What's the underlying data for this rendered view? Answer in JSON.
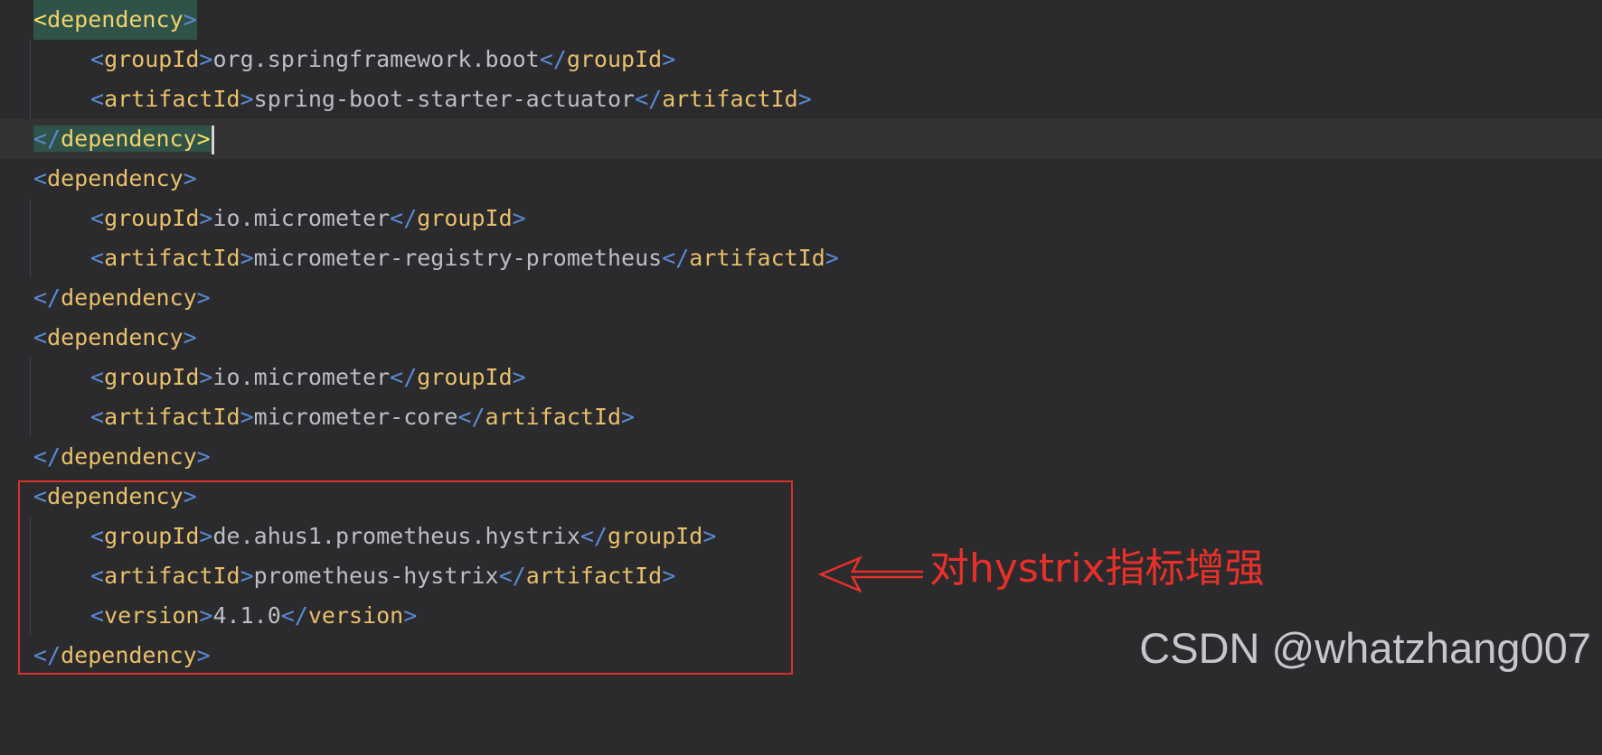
{
  "editor": {
    "lines": [
      {
        "tag": "dependency",
        "closing": false
      },
      {
        "tag": "groupId",
        "value": "org.springframework.boot"
      },
      {
        "tag": "artifactId",
        "value": "spring-boot-starter-actuator"
      },
      {
        "tag": "dependency",
        "closing": true
      },
      {
        "tag": "dependency",
        "closing": false
      },
      {
        "tag": "groupId",
        "value": "io.micrometer"
      },
      {
        "tag": "artifactId",
        "value": "micrometer-registry-prometheus"
      },
      {
        "tag": "dependency",
        "closing": true
      },
      {
        "tag": "dependency",
        "closing": false
      },
      {
        "tag": "groupId",
        "value": "io.micrometer"
      },
      {
        "tag": "artifactId",
        "value": "micrometer-core"
      },
      {
        "tag": "dependency",
        "closing": true
      },
      {
        "tag": "dependency",
        "closing": false
      },
      {
        "tag": "groupId",
        "value": "de.ahus1.prometheus.hystrix"
      },
      {
        "tag": "artifactId",
        "value": "prometheus-hystrix"
      },
      {
        "tag": "version",
        "value": "4.1.0"
      },
      {
        "tag": "dependency",
        "closing": true
      }
    ]
  },
  "annotation": {
    "text": "对hystrix指标增强",
    "color": "#e8302a"
  },
  "watermark": {
    "text": "CSDN @whatzhang007"
  },
  "colors": {
    "background": "#2b2b2d",
    "tag": "#e8bf6a",
    "bracket": "#5a8ad6",
    "text": "#bcbec4",
    "highlight_box": "#d8322a"
  }
}
